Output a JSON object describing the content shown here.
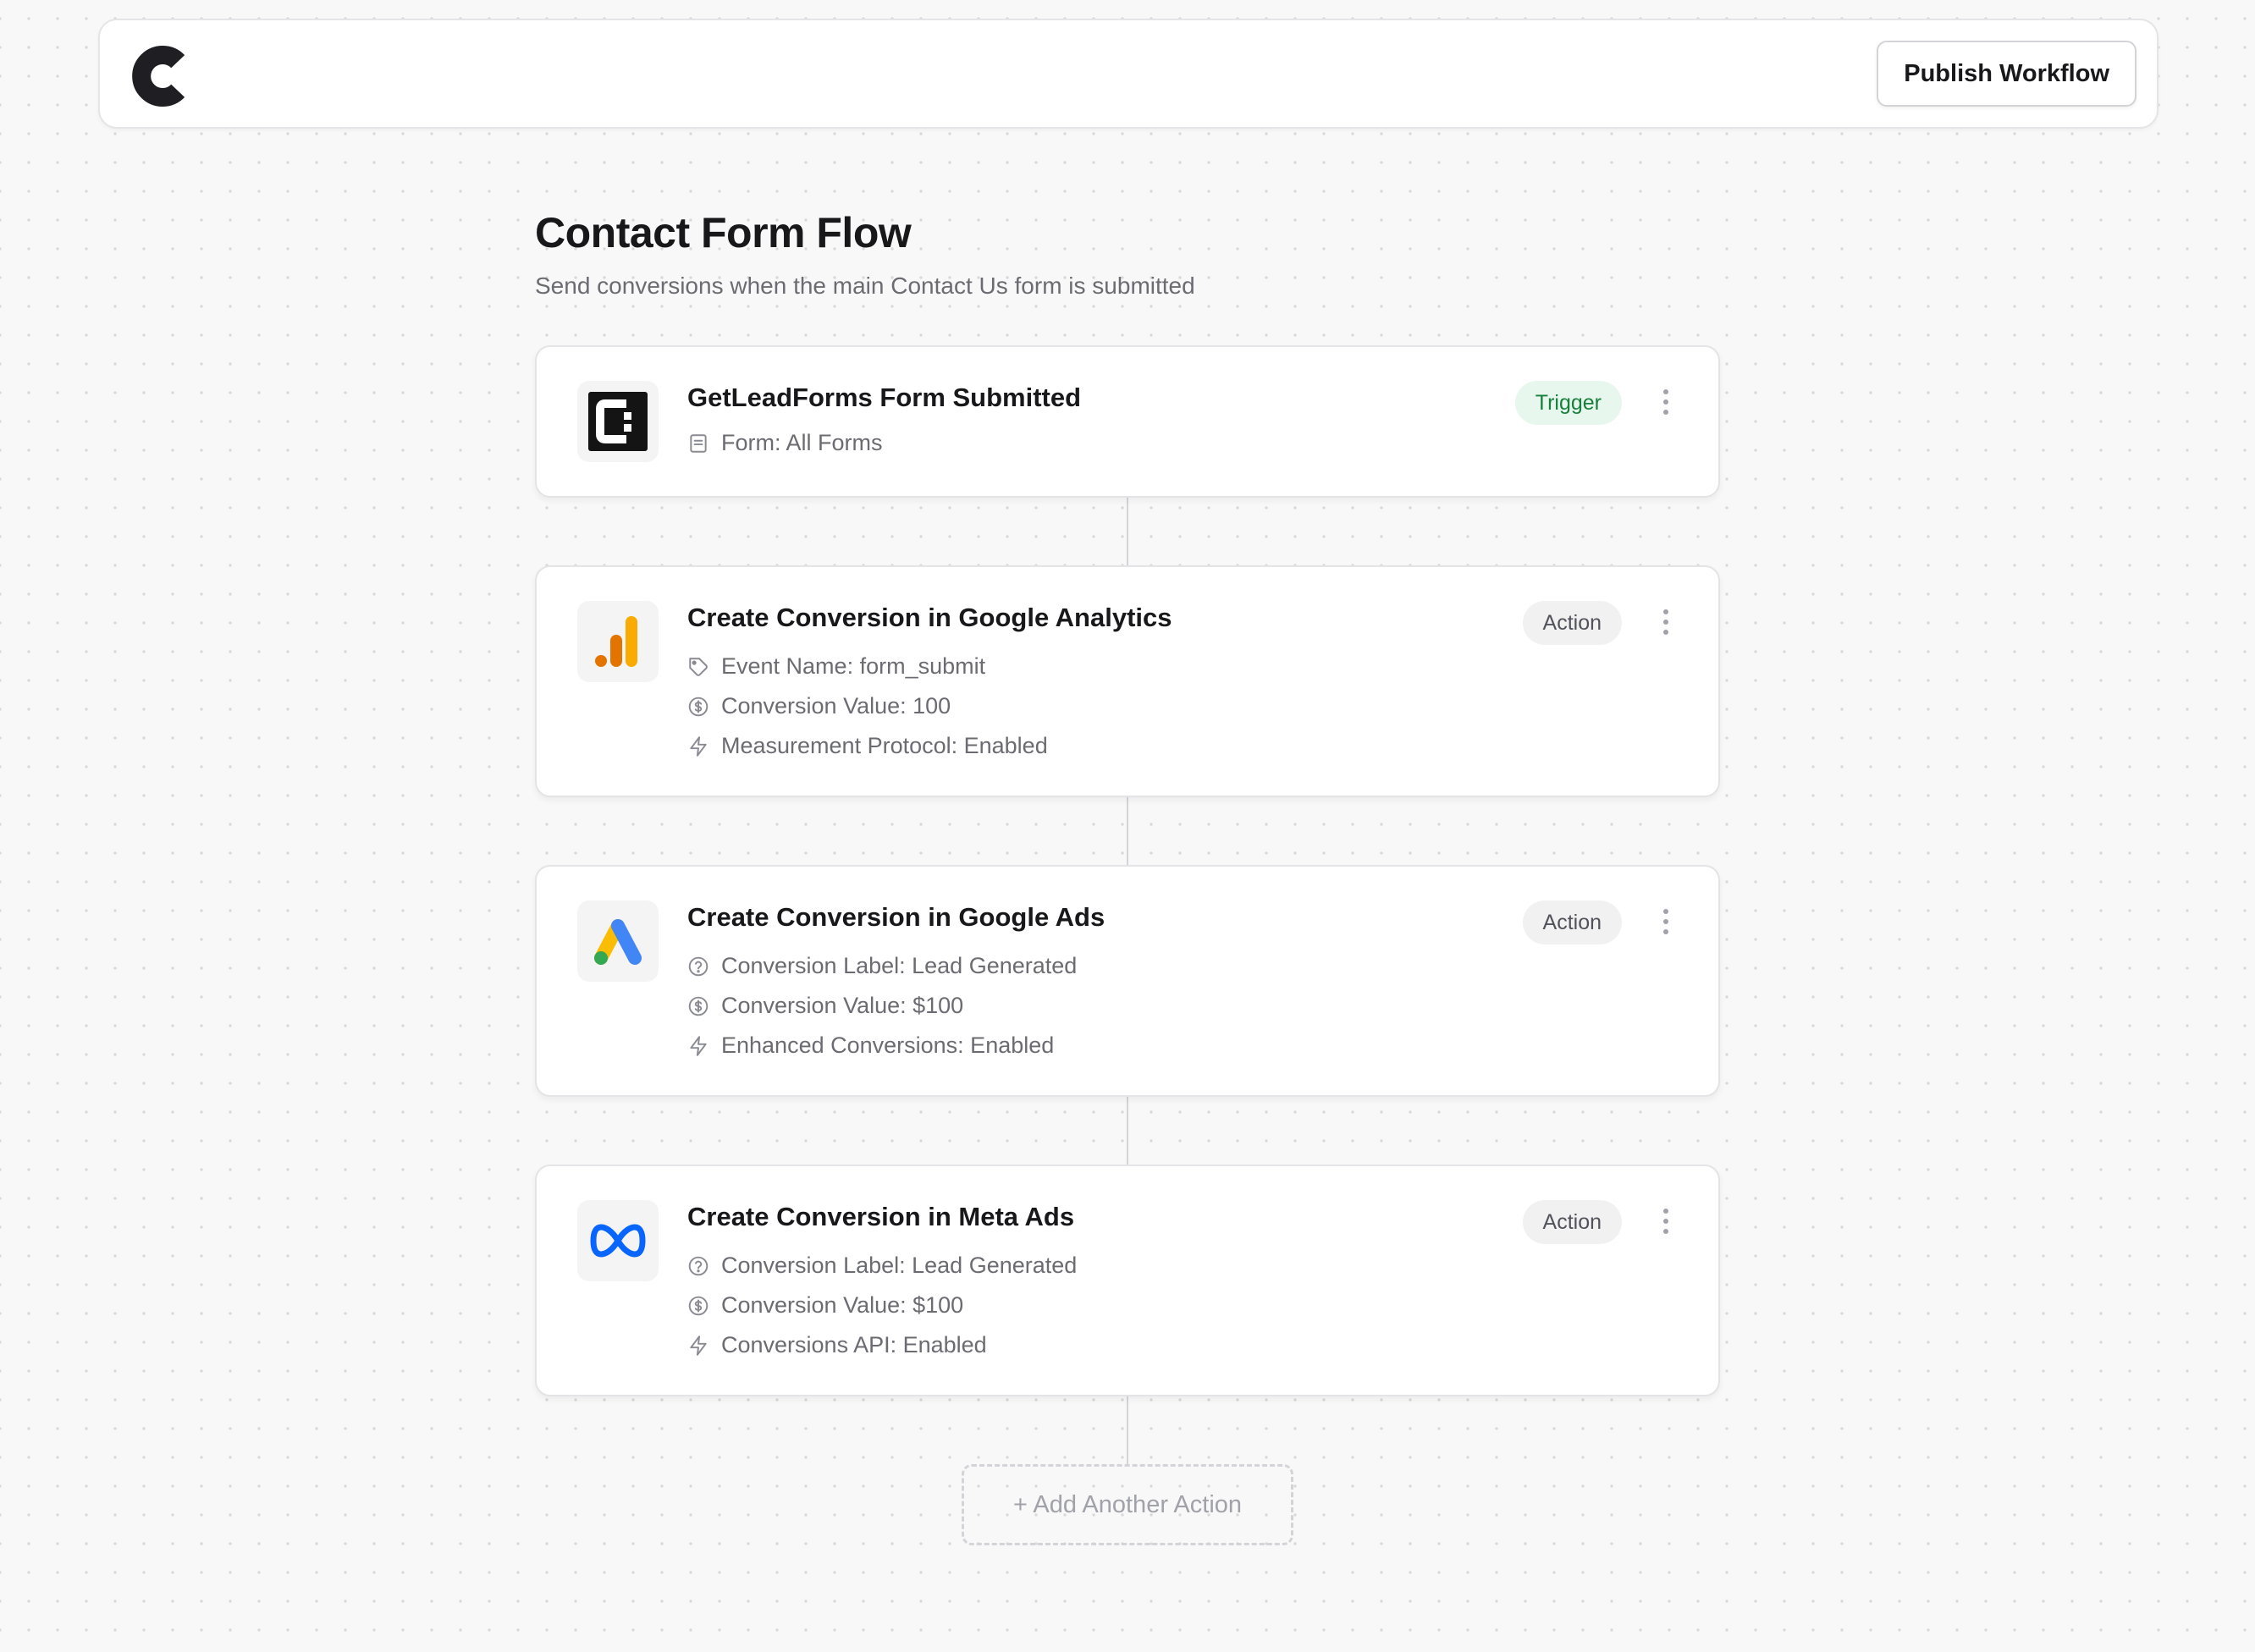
{
  "header": {
    "logo_icon": "c-logo-icon",
    "publish_label": "Publish Workflow"
  },
  "workflow": {
    "title": "Contact Form Flow",
    "subtitle": "Send conversions when the main Contact Us form is submitted"
  },
  "steps": [
    {
      "title": "GetLeadForms Form Submitted",
      "badge": "Trigger",
      "icon": "getleadforms-icon",
      "details": [
        {
          "icon": "form-icon",
          "text": "Form: All Forms"
        }
      ]
    },
    {
      "title": "Create Conversion in Google Analytics",
      "badge": "Action",
      "icon": "google-analytics-icon",
      "details": [
        {
          "icon": "tag-icon",
          "text": "Event Name: form_submit"
        },
        {
          "icon": "dollar-circle-icon",
          "text": "Conversion Value: 100"
        },
        {
          "icon": "bolt-icon",
          "text": "Measurement Protocol: Enabled"
        }
      ]
    },
    {
      "title": "Create Conversion in Google Ads",
      "badge": "Action",
      "icon": "google-ads-icon",
      "details": [
        {
          "icon": "help-circle-icon",
          "text": "Conversion Label: Lead Generated"
        },
        {
          "icon": "dollar-circle-icon",
          "text": "Conversion Value: $100"
        },
        {
          "icon": "bolt-icon",
          "text": "Enhanced Conversions: Enabled"
        }
      ]
    },
    {
      "title": "Create Conversion in Meta Ads",
      "badge": "Action",
      "icon": "meta-icon",
      "details": [
        {
          "icon": "help-circle-icon",
          "text": "Conversion Label: Lead Generated"
        },
        {
          "icon": "dollar-circle-icon",
          "text": "Conversion Value: $100"
        },
        {
          "icon": "bolt-icon",
          "text": "Conversions API: Enabled"
        }
      ]
    }
  ],
  "add_action_label": "+ Add Another Action",
  "colors": {
    "trigger_badge_bg": "#e8f7ed",
    "trigger_badge_text": "#16803c",
    "action_badge_bg": "#f1f1f2",
    "ga_orange": "#f9ab00",
    "ga_dark_orange": "#e37400",
    "ads_blue": "#4285f4",
    "ads_yellow": "#fbbc04",
    "ads_green": "#34a853",
    "meta_blue": "#0866ff"
  }
}
